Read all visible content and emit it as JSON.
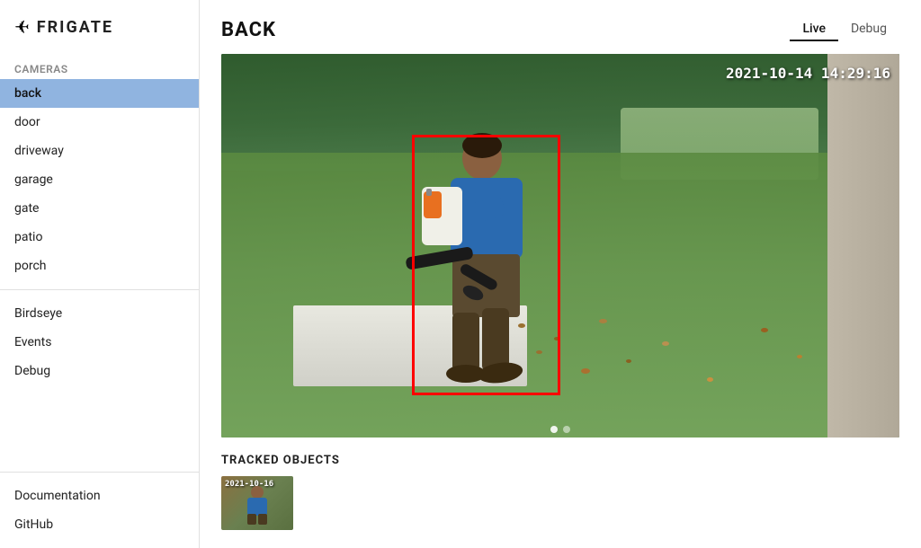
{
  "sidebar": {
    "logo": {
      "icon": "🦅",
      "text": "FRIGATE"
    },
    "cameras_label": "Cameras",
    "items": [
      {
        "id": "back",
        "label": "back",
        "active": true
      },
      {
        "id": "door",
        "label": "door",
        "active": false
      },
      {
        "id": "driveway",
        "label": "driveway",
        "active": false
      },
      {
        "id": "garage",
        "label": "garage",
        "active": false
      },
      {
        "id": "gate",
        "label": "gate",
        "active": false
      },
      {
        "id": "patio",
        "label": "patio",
        "active": false
      },
      {
        "id": "porch",
        "label": "porch",
        "active": false
      }
    ],
    "nav_items": [
      {
        "id": "birdseye",
        "label": "Birdseye"
      },
      {
        "id": "events",
        "label": "Events"
      },
      {
        "id": "debug",
        "label": "Debug"
      }
    ],
    "footer_items": [
      {
        "id": "documentation",
        "label": "Documentation"
      },
      {
        "id": "github",
        "label": "GitHub"
      }
    ]
  },
  "main": {
    "page_title": "BACK",
    "tabs": [
      {
        "id": "live",
        "label": "Live",
        "active": true
      },
      {
        "id": "debug",
        "label": "Debug",
        "active": false
      }
    ],
    "camera": {
      "timestamp": "2021-10-14 14:29:16"
    },
    "tracked_objects": {
      "label": "TRACKED OBJECTS",
      "thumb_date": "2021-10-16"
    }
  }
}
